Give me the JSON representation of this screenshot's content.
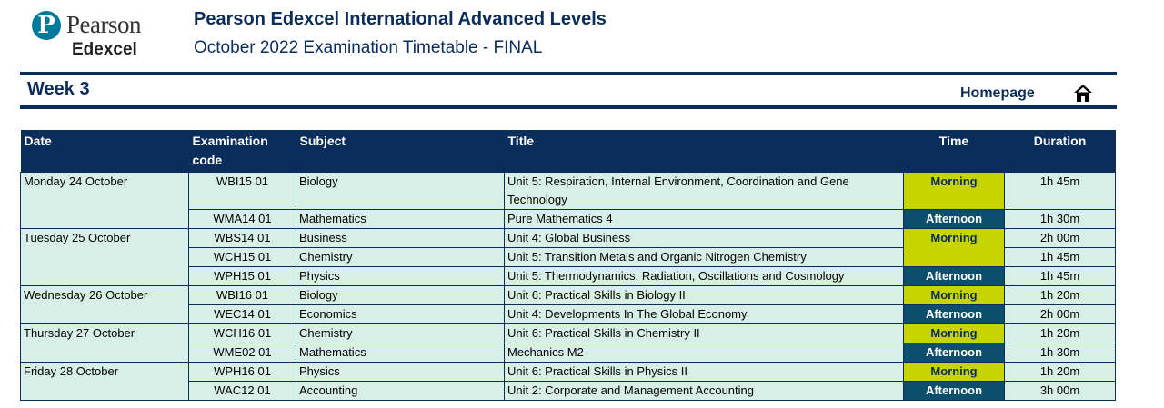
{
  "brand": {
    "mark": "P",
    "word1": "Pearson",
    "word2": "Edexcel"
  },
  "header": {
    "title": "Pearson Edexcel International Advanced Levels",
    "subtitle": "October 2022 Examination Timetable - FINAL"
  },
  "week": "Week 3",
  "homepage_label": "Homepage",
  "icons": {
    "home": "home-icon"
  },
  "colors": {
    "navy": "#0b2d5b",
    "morning": "#c8d400",
    "afternoon": "#0b4f6c",
    "row_bg": "#d8efe8"
  },
  "table": {
    "headers": [
      "Date",
      "Examination code",
      "Subject",
      "Title",
      "Time",
      "Duration"
    ],
    "rows": [
      {
        "date": "Monday 24 October",
        "code": "WBI15 01",
        "subject": "Biology",
        "title": "Unit 5: Respiration, Internal Environment, Coordination and Gene Technology",
        "time": "Morning",
        "duration": "1h 45m"
      },
      {
        "date": "",
        "code": "WMA14 01",
        "subject": "Mathematics",
        "title": "Pure Mathematics 4",
        "time": "Afternoon",
        "duration": "1h 30m"
      },
      {
        "date": "Tuesday 25 October",
        "code": "WBS14 01",
        "subject": "Business",
        "title": "Unit 4: Global Business",
        "time": "Morning",
        "duration": "2h 00m"
      },
      {
        "date": "",
        "code": "WCH15 01",
        "subject": "Chemistry",
        "title": "Unit 5: Transition Metals and Organic Nitrogen Chemistry",
        "time": "",
        "duration": "1h 45m"
      },
      {
        "date": "",
        "code": "WPH15 01",
        "subject": "Physics",
        "title": "Unit 5: Thermodynamics, Radiation, Oscillations and Cosmology",
        "time": "Afternoon",
        "duration": "1h 45m"
      },
      {
        "date": "Wednesday 26 October",
        "code": "WBI16 01",
        "subject": "Biology",
        "title": "Unit 6: Practical Skills in Biology II",
        "time": "Morning",
        "duration": "1h 20m"
      },
      {
        "date": "",
        "code": "WEC14 01",
        "subject": "Economics",
        "title": "Unit 4: Developments In The Global Economy",
        "time": "Afternoon",
        "duration": "2h 00m"
      },
      {
        "date": "Thursday 27 October",
        "code": "WCH16 01",
        "subject": "Chemistry",
        "title": "Unit 6: Practical Skills in Chemistry II",
        "time": "Morning",
        "duration": "1h 20m"
      },
      {
        "date": "",
        "code": "WME02 01",
        "subject": "Mathematics",
        "title": "Mechanics M2",
        "time": "Afternoon",
        "duration": "1h 30m"
      },
      {
        "date": "Friday 28 October",
        "code": "WPH16 01",
        "subject": "Physics",
        "title": "Unit 6: Practical Skills in Physics II",
        "time": "Morning",
        "duration": "1h 20m"
      },
      {
        "date": "",
        "code": "WAC12 01",
        "subject": "Accounting",
        "title": "Unit 2: Corporate and Management Accounting",
        "time": "Afternoon",
        "duration": "3h 00m"
      }
    ]
  }
}
